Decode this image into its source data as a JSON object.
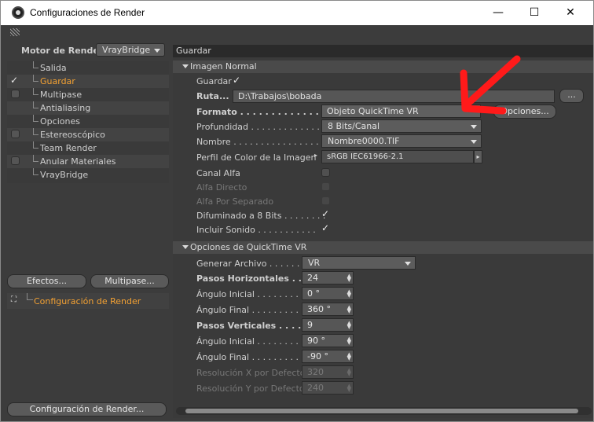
{
  "window": {
    "title": "Configuraciones de Render",
    "minimize": "—",
    "maximize": "☐",
    "close": "✕"
  },
  "left": {
    "motor_label": "Motor de Render",
    "motor_value": "VrayBridge",
    "tree": [
      {
        "label": "Salida",
        "checkbox": false,
        "checked": false,
        "selected": false
      },
      {
        "label": "Guardar",
        "checkbox": true,
        "checked": true,
        "selected": true
      },
      {
        "label": "Multipase",
        "checkbox": true,
        "checked": false,
        "selected": false
      },
      {
        "label": "Antialiasing",
        "checkbox": false,
        "checked": false,
        "selected": false
      },
      {
        "label": "Opciones",
        "checkbox": false,
        "checked": false,
        "selected": false
      },
      {
        "label": "Estereoscópico",
        "checkbox": true,
        "checked": false,
        "selected": false
      },
      {
        "label": "Team Render",
        "checkbox": false,
        "checked": false,
        "selected": false
      },
      {
        "label": "Anular Materiales",
        "checkbox": true,
        "checked": false,
        "selected": false
      },
      {
        "label": "VrayBridge",
        "checkbox": false,
        "checked": false,
        "selected": false
      }
    ],
    "efectos_button": "Efectos...",
    "multipase_button": "Multipase...",
    "config_item": "Configuración de Render",
    "config_button": "Configuración de Render..."
  },
  "right": {
    "header": "Guardar",
    "section1": "Imagen Normal",
    "guardar_label": "Guardar",
    "ruta_label": "Ruta...",
    "ruta_value": "D:\\Trabajos\\bobada",
    "ruta_button": "...",
    "formato_label": "Formato . . . . . . . . . . . . . . .",
    "formato_value": "Objeto QuickTime VR",
    "opciones_button": "Opciones...",
    "profundidad_label": "Profundidad . . . . . . . . . . . . .",
    "profundidad_value": "8 Bits/Canal",
    "nombre_label": "Nombre . . . . . . . . . . . . . . . .",
    "nombre_value": "Nombre0000.TIF",
    "perfil_label": "Perfil de Color de la Imagen",
    "perfil_value": "sRGB IEC61966-2.1",
    "canal_alfa": "Canal Alfa",
    "alfa_directo": "Alfa Directo",
    "alfa_separado": "Alfa Por Separado",
    "difuminado": "Difuminado a 8 Bits . . . . . . . .",
    "incluir_sonido": "Incluir Sonido . . . . . . . . . . .",
    "section2": "Opciones de QuickTime VR",
    "generar_label": "Generar Archivo . . . . . . . .",
    "generar_value": "VR",
    "pasos_h_label": "Pasos Horizontales . . . . .",
    "pasos_h_value": "24",
    "ang_ini_1_label": "Ángulo Inicial . . . . . . . . . .",
    "ang_ini_1_value": "0 °",
    "ang_fin_1_label": "Ángulo Final . . . . . . . . . . .",
    "ang_fin_1_value": "360 °",
    "pasos_v_label": "Pasos Verticales . . . . . . .",
    "pasos_v_value": "9",
    "ang_ini_2_label": "Ángulo Inicial . . . . . . . . . .",
    "ang_ini_2_value": "90 °",
    "ang_fin_2_label": "Ángulo Final . . . . . . . . . . .",
    "ang_fin_2_value": "-90 °",
    "res_x_label": "Resolución X por Defecto",
    "res_x_value": "320",
    "res_y_label": "Resolución Y por Defecto",
    "res_y_value": "240"
  },
  "colors": {
    "selected_text": "#f3a133",
    "annotation_arrow": "#ff1a1a"
  },
  "icons": {
    "checkmark": "✓",
    "dropdown": "chevron-down-icon",
    "spin": "spinner-arrows-icon"
  }
}
